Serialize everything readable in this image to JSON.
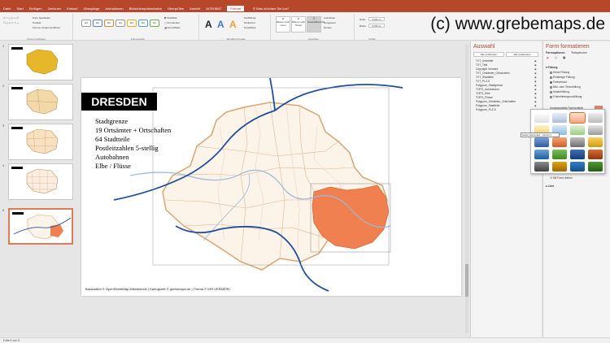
{
  "ribbon_tabs": [
    "Datei",
    "Start",
    "Einfügen",
    "Zeichnen",
    "Entwurf",
    "Übergänge",
    "Animationen",
    "Bildschirmpräsentation",
    "Überprüfen",
    "Ansicht",
    "ACROBAT",
    "Format"
  ],
  "tell_me": "Was möchten Sie tun?",
  "watermark": "(c) www.grebemaps.de",
  "ribbon": {
    "insert_shapes_label": "Formen einfügen",
    "shape_styles_label": "Formenarten",
    "wordart_label": "WordArt-Formate",
    "arrange_label": "Anordnen",
    "size_label": "Größe",
    "shape_style_text": "Abc",
    "wordart_letter": "A",
    "fill": "Fülleffekt",
    "outline": "Formkontur",
    "effects": "Formeffekte",
    "text_fill": "Textfüllung",
    "text_outline": "Textkontur",
    "text_effects": "Texteffekte",
    "bring_forward": "Ebene nach vorne",
    "send_backward": "Ebene nach hinten",
    "selection_pane": "Auswahlbereich",
    "align": "Ausrichten",
    "group": "Gruppieren",
    "rotate": "Drehen",
    "height_label": "Höhe:",
    "height_value": "5,08 cm",
    "width_label": "Breite:",
    "width_value": "5,08 cm",
    "edit_shape": "Form bearbeiten",
    "textbox": "Textfeld",
    "merge_shapes": "Formen zusammenführen"
  },
  "slides": [
    {
      "number": "1"
    },
    {
      "number": "2"
    },
    {
      "number": "3"
    },
    {
      "number": "4"
    },
    {
      "number": "5"
    }
  ],
  "slide": {
    "title": "DRESDEN",
    "bullets": [
      "Stadtgrenze",
      "19 Ortsämter + Ortschaften",
      "64 Stadtteile",
      "Postleitzahlen 5-stellig",
      "Autobahnen",
      "Elbe / Flüsse"
    ],
    "source": "Basisdaten © OpenStreetMap-Mitwirkende | Kartografie © grebemaps.de | Thema © IHR VERMERK"
  },
  "selection_pane": {
    "title": "Auswahl",
    "show_all": "Alle einblenden",
    "hide_all": "Alle ausblenden",
    "items": [
      "TXT_Untertitel",
      "TXT_Titel",
      "Copyright Vermerk",
      "TXT_Ortsämter_Ortschaften",
      "TXT_Stadtteile",
      "TXT_PLZ-5",
      "Polygone_Stadtgrenze",
      "TOPO_Autobahnen",
      "TOPO_Elbe",
      "TOPO_Flüsse",
      "Polygone_Ortsämter_Ortschaften",
      "Polygone_Stadtteile",
      "Polygone_PLZ-5"
    ]
  },
  "format_pane": {
    "title": "Form formatieren",
    "tab_shape": "Formoptionen",
    "tab_text": "Textoptionen",
    "section_fill": "Füllung",
    "fill_options": [
      "Keine Füllung",
      "Einfarbige Füllung",
      "Farbverlauf",
      "Bild- oder Texturfüllung",
      "Musterfüllung",
      "Folienhintergrundfüllung"
    ],
    "preset_gradients": "Voreingestellte Farbverläufe",
    "transparency_label": "Helligkeit",
    "transparency_value": "100 %",
    "rotate_with_shape": "Mit Form drehen",
    "section_line": "Linie"
  },
  "tooltip": "Heller Farbverlauf – Akzent 2",
  "status": "Folie 5 von 5",
  "colors": {
    "accent": "#b7472a",
    "map_fill": "#fcf3e9",
    "map_border": "#d6a774",
    "highlight": "#f08050",
    "river": "#9cb8dc",
    "highway": "#1f4f9e"
  }
}
